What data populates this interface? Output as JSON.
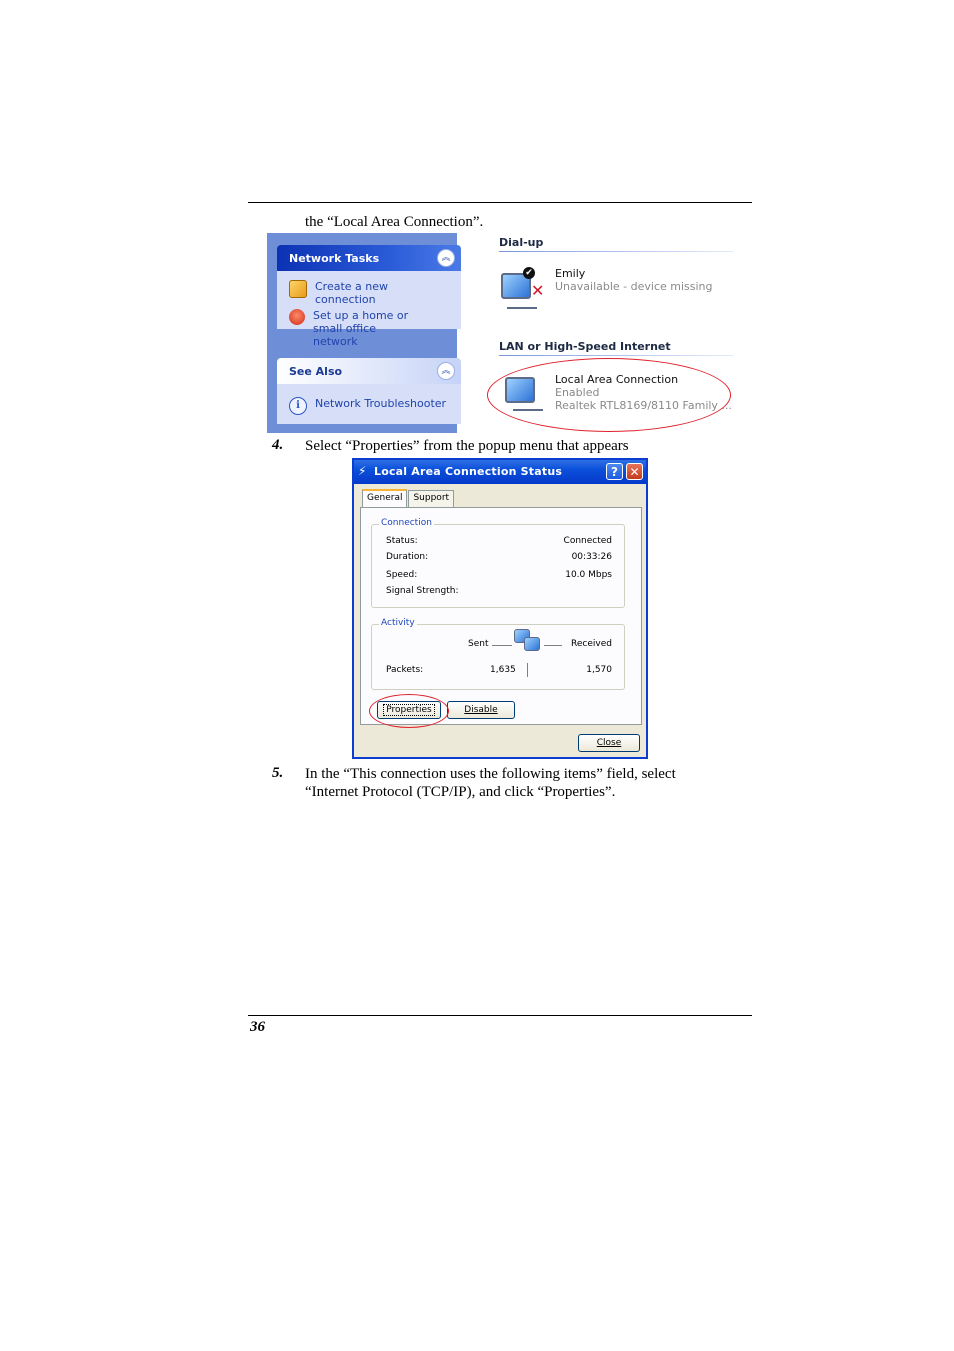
{
  "intro_text": "the “Local Area Connection”.",
  "network_window": {
    "tasks_panel": {
      "title": "Network Tasks",
      "items": [
        "Create a new connection",
        "Set up a home or small office network"
      ]
    },
    "see_also_panel": {
      "title": "See Also",
      "items": [
        "Network Troubleshooter"
      ]
    },
    "groups": [
      {
        "heading": "Dial-up",
        "connection": {
          "name": "Emily",
          "status": "Unavailable - device missing"
        }
      },
      {
        "heading": "LAN or High-Speed Internet",
        "connection": {
          "name": "Local Area Connection",
          "status": "Enabled",
          "device": "Realtek RTL8169/8110 Family ..."
        }
      }
    ],
    "icons": [
      "collapse-chevron-icon",
      "new-connection-icon",
      "home-network-icon",
      "info-icon",
      "network-connection-icon"
    ]
  },
  "step4": {
    "number": "4.",
    "text": "Select “Properties” from the popup menu that appears"
  },
  "status_dialog": {
    "title": "Local Area Connection Status",
    "help_button": "?",
    "close_x": "✕",
    "tabs": [
      "General",
      "Support"
    ],
    "connection_group": {
      "label": "Connection",
      "rows": [
        {
          "label": "Status:",
          "value": "Connected"
        },
        {
          "label": "Duration:",
          "value": "00:33:26"
        },
        {
          "label": "Speed:",
          "value": "10.0 Mbps"
        },
        {
          "label": "Signal Strength:",
          "value": ""
        }
      ]
    },
    "activity_group": {
      "label": "Activity",
      "sent_label": "Sent",
      "received_label": "Received",
      "packets_label": "Packets:",
      "packets_sent": "1,635",
      "packets_received": "1,570"
    },
    "buttons": {
      "properties": "Properties",
      "disable": "Disable",
      "close": "Close"
    }
  },
  "step5": {
    "number": "5.",
    "line1": "In the “This connection uses the following items” field, select",
    "line2": "“Internet Protocol (TCP/IP), and click “Properties”."
  },
  "page_number": "36",
  "colors": {
    "highlight": "#e0212b",
    "xp_blue": "#0a4fdb",
    "task_link": "#2143aa"
  }
}
